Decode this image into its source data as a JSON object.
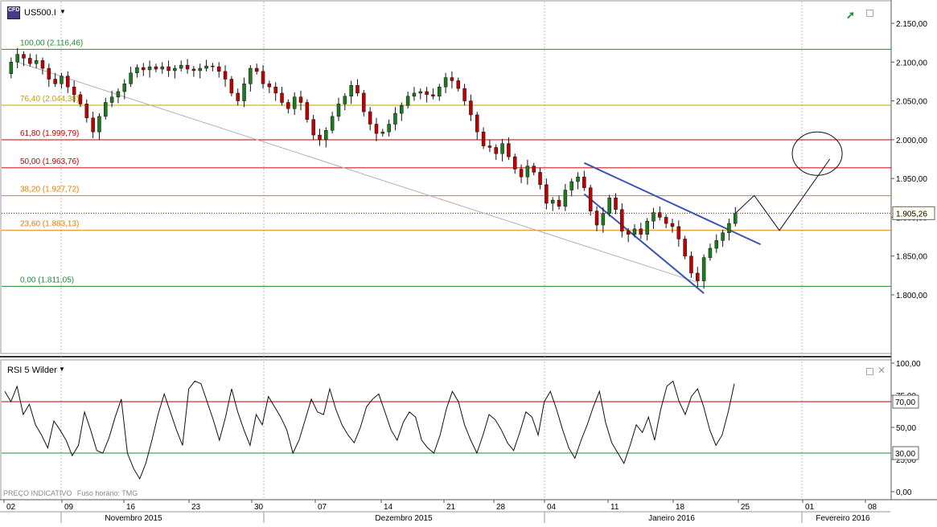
{
  "header": {
    "symbol": "US500.I",
    "dropdown_icon": "caret-down-icon",
    "instrument_icon": "cfd-instrument-icon",
    "trend_icon": "trend-up-icon",
    "window_icon": "restore-window-icon"
  },
  "rsi_panel": {
    "title": "RSI 5 Wilder",
    "footer_label": "PREÇO INDICATIVO",
    "timezone_label": "Fuso horário: TMG",
    "window_icon": "restore-window-icon",
    "close_icon": "close-icon"
  },
  "colors": {
    "fib_green": "#1e8c3a",
    "fib_red": "#c00000",
    "fib_orange": "#e08000",
    "fib_gold": "#c8a000",
    "trendline_blue": "#3b53b5",
    "candle_green": "#1e7a1e",
    "candle_red": "#c00000",
    "current_price_bg": "#fffff0"
  },
  "chart_data": [
    {
      "type": "candlestick",
      "symbol": "US500.I",
      "y_axis_ticks": [
        "2.150,00",
        "2.100,00",
        "2.050,00",
        "2.000,00",
        "1.950,00",
        "1.900,00",
        "1.850,00",
        "1.800,00"
      ],
      "ylim": [
        1785,
        2165
      ],
      "current_price_label": "1.905,26",
      "current_price": 1905.26,
      "fib_levels": [
        {
          "label": "100,00 (2.116,46)",
          "value": 2116.46,
          "color": "#1e8c3a"
        },
        {
          "label": "76,40 (2.044,38)",
          "value": 2044.38,
          "color": "#c8a000"
        },
        {
          "label": "61,80 (1.999,79)",
          "value": 1999.79,
          "color": "#c00000"
        },
        {
          "label": "50,00 (1.963,76)",
          "value": 1963.76,
          "color": "#c00000"
        },
        {
          "label": "38,20 (1.927,72)",
          "value": 1927.72,
          "color": "#e08000"
        },
        {
          "label": "23,60 (1.883,13)",
          "value": 1883.13,
          "color": "#e08000"
        },
        {
          "label": "0,00 (1.811,05)",
          "value": 1811.05,
          "color": "#1e8c3a"
        }
      ],
      "close_path": [
        [
          0,
          2085
        ],
        [
          1,
          2100
        ],
        [
          2,
          2110
        ],
        [
          3,
          2105
        ],
        [
          4,
          2098
        ],
        [
          5,
          2102
        ],
        [
          6,
          2092
        ],
        [
          7,
          2078
        ],
        [
          8,
          2072
        ],
        [
          9,
          2082
        ],
        [
          10,
          2068
        ],
        [
          11,
          2058
        ],
        [
          12,
          2046
        ],
        [
          13,
          2028
        ],
        [
          14,
          2010
        ],
        [
          15,
          2030
        ],
        [
          16,
          2048
        ],
        [
          17,
          2055
        ],
        [
          18,
          2062
        ],
        [
          19,
          2072
        ],
        [
          20,
          2086
        ],
        [
          21,
          2093
        ],
        [
          22,
          2090
        ],
        [
          23,
          2094
        ],
        [
          24,
          2091
        ],
        [
          25,
          2094
        ],
        [
          26,
          2089
        ],
        [
          27,
          2092
        ],
        [
          28,
          2096
        ],
        [
          29,
          2091
        ],
        [
          30,
          2089
        ],
        [
          31,
          2092
        ],
        [
          32,
          2095
        ],
        [
          33,
          2094
        ],
        [
          34,
          2088
        ],
        [
          35,
          2078
        ],
        [
          36,
          2060
        ],
        [
          37,
          2050
        ],
        [
          38,
          2072
        ],
        [
          39,
          2092
        ],
        [
          40,
          2088
        ],
        [
          41,
          2072
        ],
        [
          42,
          2068
        ],
        [
          43,
          2060
        ],
        [
          44,
          2048
        ],
        [
          45,
          2040
        ],
        [
          46,
          2055
        ],
        [
          47,
          2048
        ],
        [
          48,
          2026
        ],
        [
          49,
          2006
        ],
        [
          50,
          2000
        ],
        [
          51,
          2012
        ],
        [
          52,
          2030
        ],
        [
          53,
          2046
        ],
        [
          54,
          2056
        ],
        [
          55,
          2070
        ],
        [
          56,
          2060
        ],
        [
          57,
          2036
        ],
        [
          58,
          2020
        ],
        [
          59,
          2008
        ],
        [
          60,
          2010
        ],
        [
          61,
          2020
        ],
        [
          62,
          2034
        ],
        [
          63,
          2044
        ],
        [
          64,
          2056
        ],
        [
          65,
          2060
        ],
        [
          66,
          2062
        ],
        [
          67,
          2058
        ],
        [
          68,
          2056
        ],
        [
          69,
          2068
        ],
        [
          70,
          2080
        ],
        [
          71,
          2076
        ],
        [
          72,
          2066
        ],
        [
          73,
          2050
        ],
        [
          74,
          2032
        ],
        [
          75,
          2010
        ],
        [
          76,
          1992
        ],
        [
          77,
          1990
        ],
        [
          78,
          1982
        ],
        [
          79,
          1995
        ],
        [
          80,
          1978
        ],
        [
          81,
          1962
        ],
        [
          82,
          1952
        ],
        [
          83,
          1966
        ],
        [
          84,
          1958
        ],
        [
          85,
          1942
        ],
        [
          86,
          1918
        ],
        [
          87,
          1922
        ],
        [
          88,
          1914
        ],
        [
          89,
          1935
        ],
        [
          90,
          1946
        ],
        [
          91,
          1952
        ],
        [
          92,
          1938
        ],
        [
          93,
          1908
        ],
        [
          94,
          1890
        ],
        [
          95,
          1905
        ],
        [
          96,
          1925
        ],
        [
          97,
          1910
        ],
        [
          98,
          1882
        ],
        [
          99,
          1878
        ],
        [
          100,
          1885
        ],
        [
          101,
          1878
        ],
        [
          102,
          1895
        ],
        [
          103,
          1906
        ],
        [
          104,
          1900
        ],
        [
          105,
          1892
        ],
        [
          106,
          1888
        ],
        [
          107,
          1872
        ],
        [
          108,
          1850
        ],
        [
          109,
          1828
        ],
        [
          110,
          1818
        ],
        [
          111,
          1848
        ],
        [
          112,
          1860
        ],
        [
          113,
          1870
        ],
        [
          114,
          1880
        ],
        [
          115,
          1892
        ],
        [
          116,
          1905
        ]
      ],
      "projection_path": [
        [
          116,
          1905
        ],
        [
          119,
          1928
        ],
        [
          123,
          1883
        ],
        [
          131,
          1975
        ]
      ],
      "target_circle": {
        "x": 129,
        "y": 1982
      },
      "trendlines": [
        {
          "from": [
            2,
            2100
          ],
          "to": [
            110,
            1816
          ],
          "color": "#b0b0b0"
        },
        {
          "from": [
            92,
            1970
          ],
          "to": [
            120,
            1865
          ],
          "color": "#3b53b5"
        },
        {
          "from": [
            92,
            1930
          ],
          "to": [
            111,
            1802
          ],
          "color": "#3b53b5"
        }
      ],
      "x_axis_day_labels": [
        "02",
        "09",
        "16",
        "23",
        "30",
        "07",
        "14",
        "21",
        "28",
        "04",
        "11",
        "18",
        "25",
        "01",
        "08"
      ],
      "x_axis_month_labels": [
        "Novembro 2015",
        "Dezembro 2015",
        "Janeiro 2016",
        "Fevereiro 2016"
      ]
    },
    {
      "type": "line",
      "title": "RSI 5 Wilder",
      "y_axis_ticks": [
        "100,00",
        "75,00",
        "50,00",
        "25,00",
        "0,00"
      ],
      "ylim": [
        0,
        100
      ],
      "levels": [
        {
          "label": "70,00",
          "value": 70,
          "color": "#c00000"
        },
        {
          "label": "30,00",
          "value": 30,
          "color": "#1e8c3a"
        }
      ],
      "values": [
        78,
        70,
        82,
        60,
        68,
        52,
        44,
        34,
        55,
        48,
        40,
        28,
        36,
        62,
        48,
        32,
        30,
        42,
        58,
        72,
        30,
        18,
        10,
        22,
        40,
        60,
        76,
        62,
        48,
        36,
        80,
        86,
        84,
        70,
        56,
        40,
        58,
        80,
        62,
        48,
        36,
        60,
        52,
        74,
        66,
        58,
        48,
        30,
        40,
        56,
        72,
        62,
        60,
        80,
        64,
        52,
        44,
        38,
        50,
        66,
        72,
        76,
        62,
        48,
        40,
        54,
        62,
        58,
        40,
        34,
        30,
        44,
        64,
        78,
        70,
        52,
        40,
        30,
        44,
        60,
        56,
        48,
        38,
        32,
        46,
        62,
        58,
        44,
        70,
        78,
        64,
        48,
        34,
        26,
        40,
        52,
        66,
        78,
        54,
        38,
        30,
        22,
        36,
        52,
        46,
        58,
        40,
        64,
        82,
        86,
        70,
        60,
        74,
        80,
        66,
        48,
        36,
        44,
        62,
        84
      ],
      "footer_label": "PREÇO INDICATIVO"
    }
  ]
}
